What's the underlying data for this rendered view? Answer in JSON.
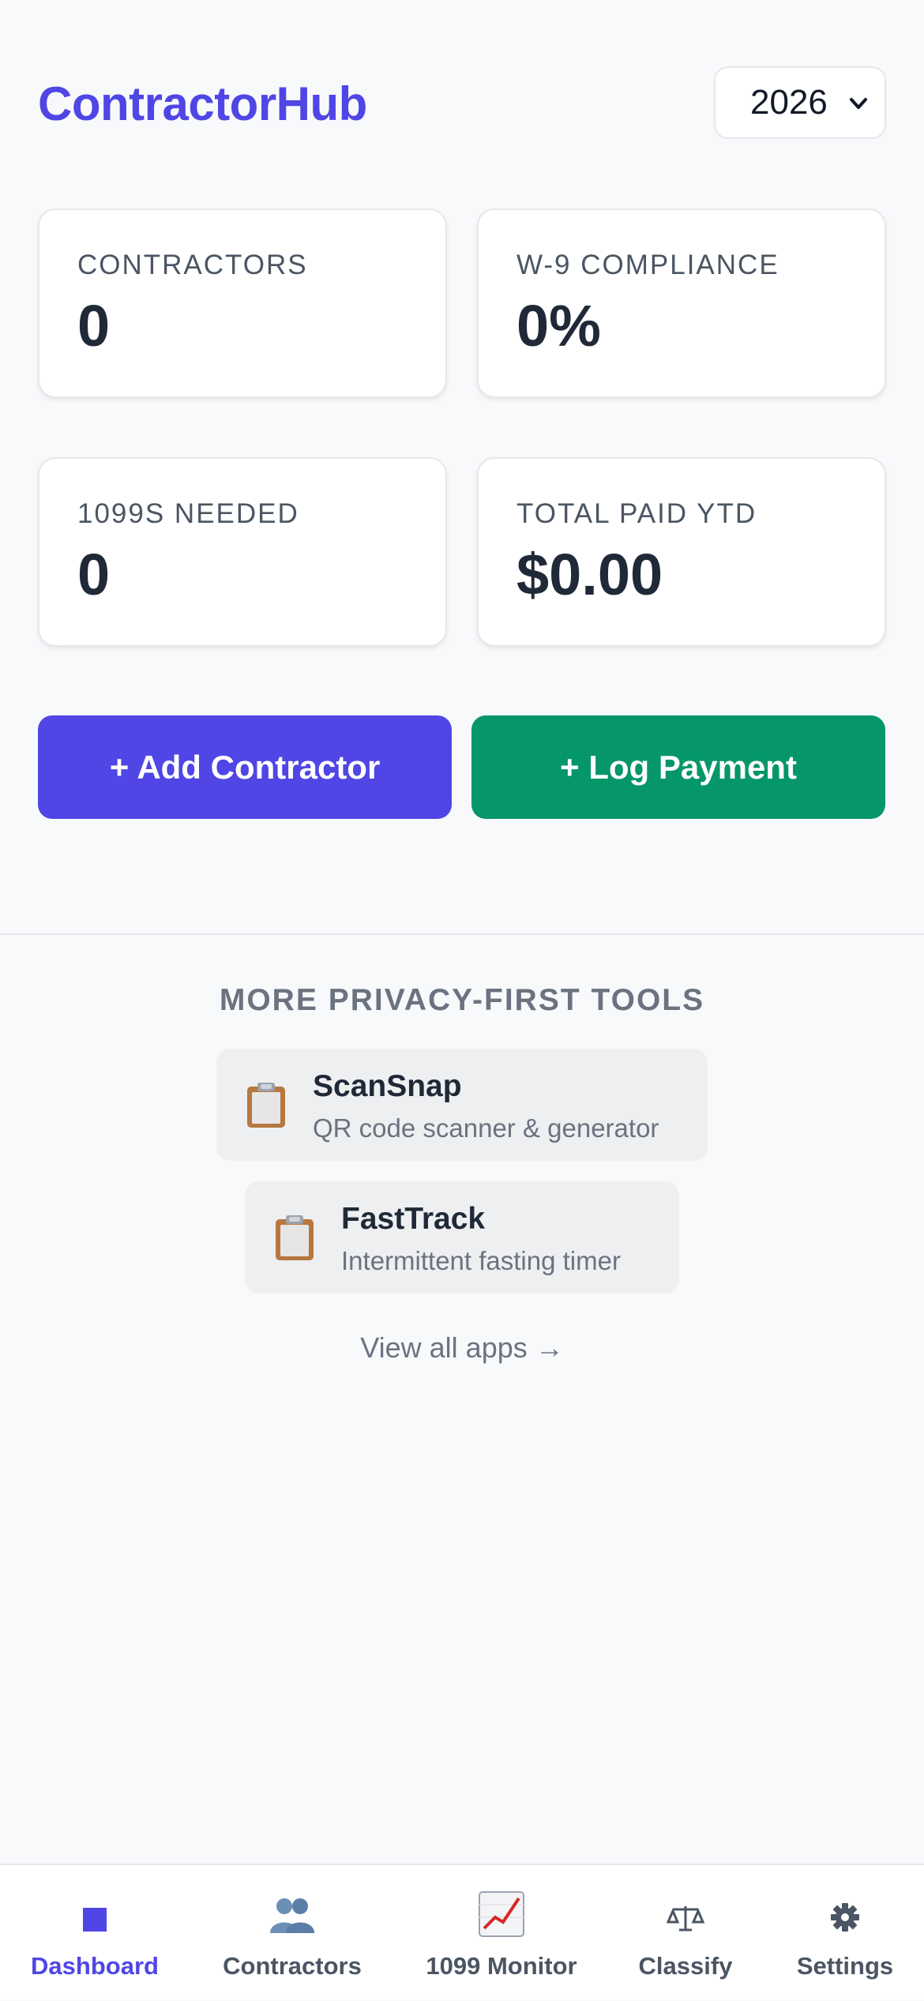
{
  "header": {
    "app_title": "ContractorHub",
    "year_select": {
      "selected": "2026"
    }
  },
  "stats": {
    "contractors": {
      "label": "CONTRACTORS",
      "value": "0"
    },
    "w9_compliance": {
      "label": "W-9 COMPLIANCE",
      "value": "0%"
    },
    "forms_1099_needed": {
      "label": "1099S NEEDED",
      "value": "0"
    },
    "total_paid_ytd": {
      "label": "TOTAL PAID YTD",
      "value": "$0.00"
    }
  },
  "actions": {
    "add_contractor": "+ Add Contractor",
    "log_payment": "+ Log Payment"
  },
  "colors": {
    "brand": "#4f46e5",
    "success": "#059669",
    "background": "#f8f9fb"
  },
  "promo": {
    "title": "MORE PRIVACY-FIRST TOOLS",
    "apps": [
      {
        "icon": "clipboard-icon",
        "name": "ScanSnap",
        "description": "QR code scanner & generator"
      },
      {
        "icon": "clipboard-icon",
        "name": "FastTrack",
        "description": "Intermittent fasting timer"
      }
    ],
    "view_all": "View all apps →"
  },
  "tabs": [
    {
      "icon": "dashboard-square-icon",
      "label": "Dashboard",
      "active": true
    },
    {
      "icon": "people-icon",
      "label": "Contractors",
      "active": false
    },
    {
      "icon": "chart-increasing-icon",
      "label": "1099 Monitor",
      "active": false
    },
    {
      "icon": "balance-scale-icon",
      "label": "Classify",
      "active": false
    },
    {
      "icon": "gear-icon",
      "label": "Settings",
      "active": false
    }
  ]
}
